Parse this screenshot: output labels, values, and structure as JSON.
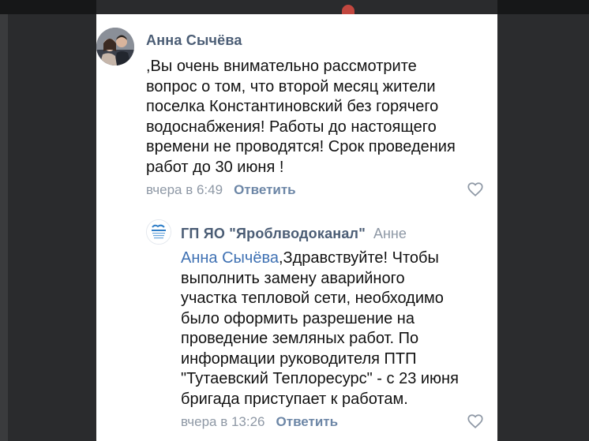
{
  "background": {
    "accent_color": "#c2473f"
  },
  "comment": {
    "author": "Анна Сычёва",
    "lines": [
      ",Вы очень внимательно рассмотрите",
      "вопрос о том, что второй месяц жители",
      "поселка Константиновский без горячего",
      "водоснабжения! Работы до настоящего",
      "времени не проводятся! Срок проведения",
      "работ до 30 июня !"
    ],
    "time": "вчера в 6:49",
    "reply_label": "Ответить",
    "like_icon": "heart-outline-icon"
  },
  "reply": {
    "author": "ГП ЯО \"Яроблводоканал\"",
    "addressee": "Анне",
    "mention": "Анна Сычёва",
    "first_line_rest": ",Здравствуйте! Чтобы",
    "lines": [
      "выполнить замену аварийного",
      "участка тепловой сети, необходимо",
      "было оформить разрешение на",
      "проведение земляных работ. По",
      "информации руководителя ПТП",
      "\"Тутаевский Теплоресурс\" - с 23 июня",
      "бригада приступает к работам."
    ],
    "time": "вчера в 13:26",
    "reply_label": "Ответить",
    "like_icon": "heart-outline-icon"
  }
}
